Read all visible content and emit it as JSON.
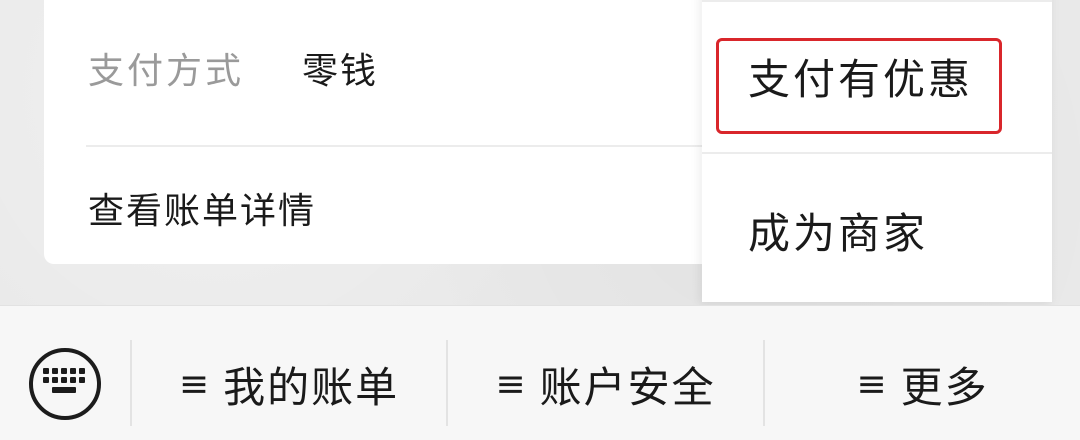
{
  "card": {
    "pay_method_label": "支付方式",
    "pay_method_value": "零钱",
    "view_bill_details": "查看账单详情"
  },
  "popup_menu": {
    "items": [
      {
        "label": "支付有优惠",
        "highlighted": true
      },
      {
        "label": "成为商家",
        "highlighted": false
      }
    ],
    "highlight_color": "#d9262b"
  },
  "bottom_bar": {
    "keyboard_icon": "keyboard-icon",
    "menus": [
      {
        "icon": "≡",
        "label": "我的账单"
      },
      {
        "icon": "≡",
        "label": "账户安全"
      },
      {
        "icon": "≡",
        "label": "更多"
      }
    ]
  }
}
